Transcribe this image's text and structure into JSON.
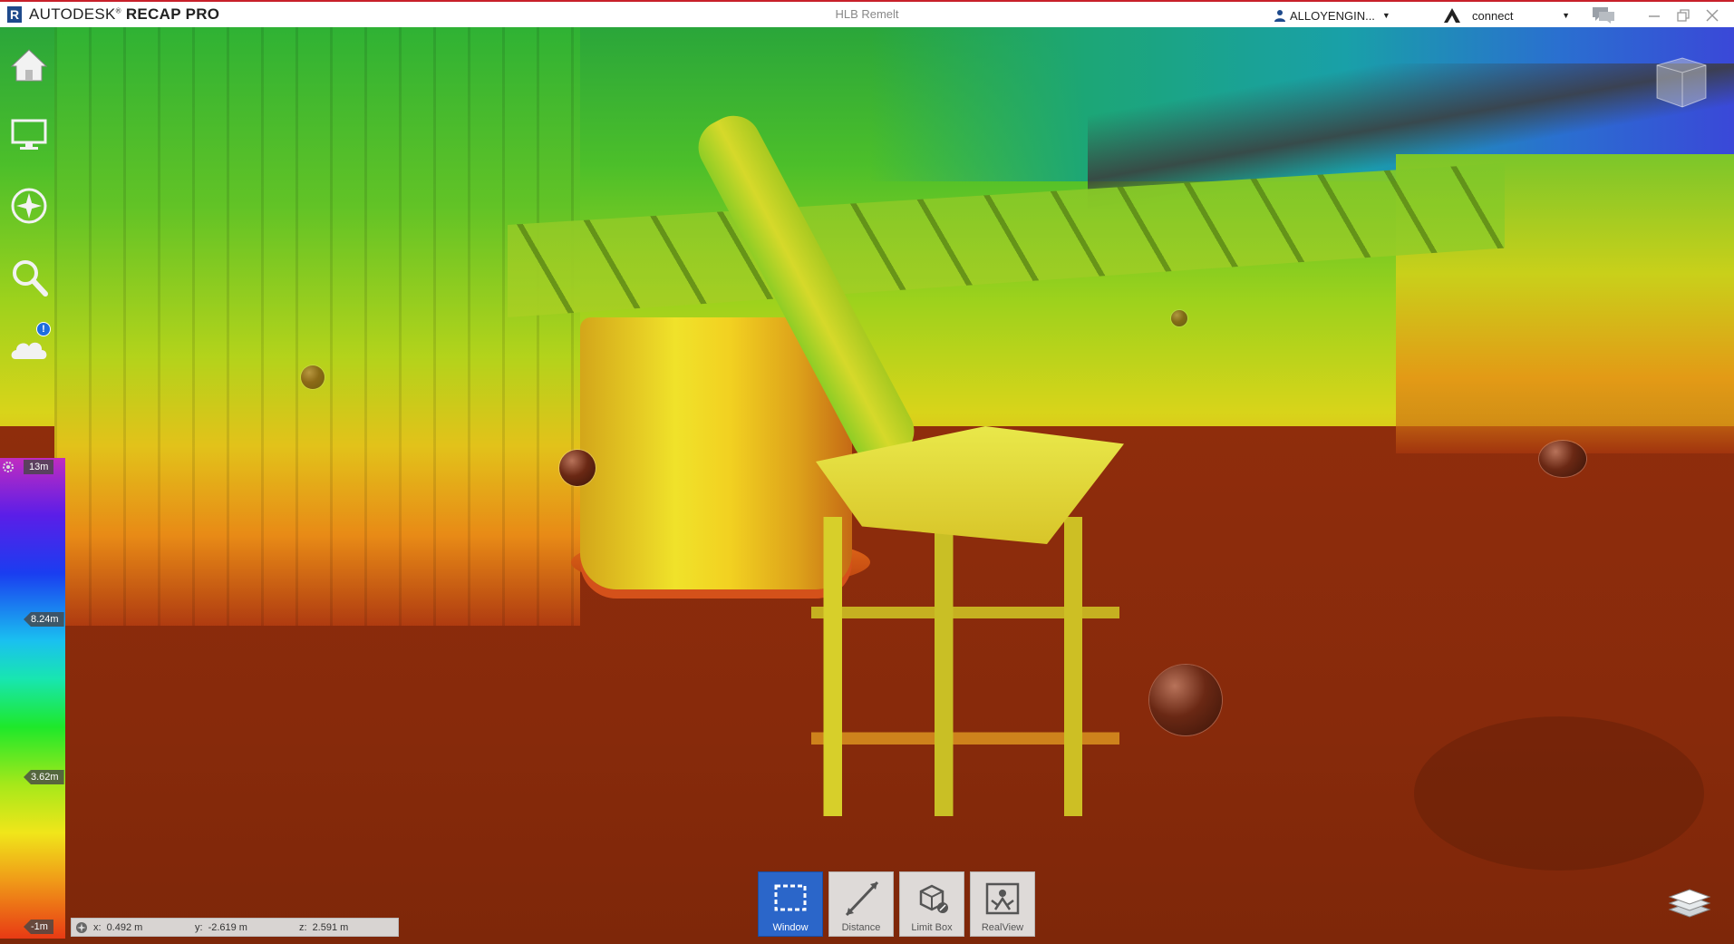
{
  "app": {
    "brand_main": "AUTODESK",
    "brand_suffix": "RECAP PRO",
    "logo_letter": "R",
    "document_title": "HLB Remelt"
  },
  "titlebar": {
    "user": "ALLOYENGIN...",
    "connect": "connect",
    "icons": [
      "chat-icon",
      "minimize-icon",
      "restore-icon",
      "close-icon"
    ]
  },
  "nav_tools": [
    {
      "id": "home",
      "icon": "home-icon"
    },
    {
      "id": "display-settings",
      "icon": "monitor-icon"
    },
    {
      "id": "navigation",
      "icon": "compass-icon"
    },
    {
      "id": "search",
      "icon": "magnifier-icon"
    },
    {
      "id": "cloud",
      "icon": "cloud-icon",
      "badge": "!"
    }
  ],
  "legend": {
    "top": "13m",
    "mid1": "8.24m",
    "mid2": "3.62m",
    "bottom": "-1m"
  },
  "coords": {
    "x_label": "x:",
    "x_value": "0.492   m",
    "y_label": "y:",
    "y_value": "-2.619   m",
    "z_label": "z:",
    "z_value": "2.591   m"
  },
  "bottom_tools": [
    {
      "id": "window",
      "label": "Window",
      "active": true
    },
    {
      "id": "distance",
      "label": "Distance",
      "active": false
    },
    {
      "id": "limit-box",
      "label": "Limit Box",
      "active": false
    },
    {
      "id": "realview",
      "label": "RealView",
      "active": false
    }
  ],
  "colors": {
    "accent": "#2b66c9",
    "titlebar_border": "#c8202a",
    "brand_blue": "#1e4a8c"
  }
}
